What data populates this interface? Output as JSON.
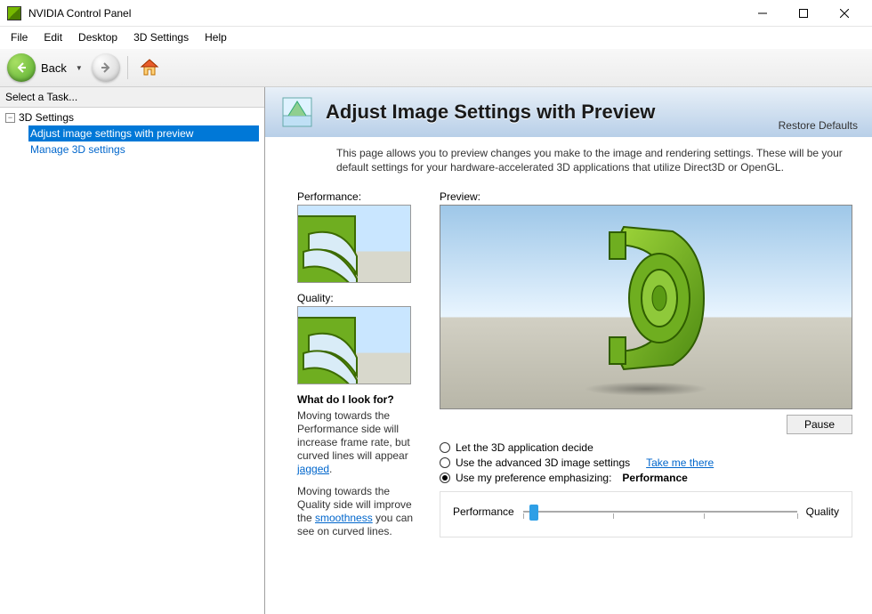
{
  "window": {
    "title": "NVIDIA Control Panel"
  },
  "menubar": [
    "File",
    "Edit",
    "Desktop",
    "3D Settings",
    "Help"
  ],
  "toolbar": {
    "back_label": "Back"
  },
  "sidebar": {
    "header": "Select a Task...",
    "root_label": "3D Settings",
    "children": [
      {
        "label": "Adjust image settings with preview",
        "selected": true
      },
      {
        "label": "Manage 3D settings",
        "selected": false
      }
    ]
  },
  "page": {
    "title": "Adjust Image Settings with Preview",
    "restore_label": "Restore Defaults",
    "description": "This page allows you to preview changes you make to the image and rendering settings. These will be your default settings for your hardware-accelerated 3D applications that utilize Direct3D or OpenGL."
  },
  "left": {
    "perf_label": "Performance:",
    "qual_label": "Quality:",
    "what_header": "What do I look for?",
    "what_p1a": "Moving towards the Performance side will increase frame rate, but curved lines will appear ",
    "what_p1_link": "jagged",
    "what_p1b": ".",
    "what_p2a": "Moving towards the Quality side will improve the ",
    "what_p2_link": "smoothness",
    "what_p2b": " you can see on curved lines."
  },
  "right": {
    "preview_label": "Preview:",
    "pause_label": "Pause",
    "radio1": "Let the 3D application decide",
    "radio2": "Use the advanced 3D image settings",
    "take_me": "Take me there",
    "radio3": "Use my preference emphasizing:",
    "emphasis_value": "Performance",
    "slider_left": "Performance",
    "slider_right": "Quality",
    "slider_pct": 4
  }
}
